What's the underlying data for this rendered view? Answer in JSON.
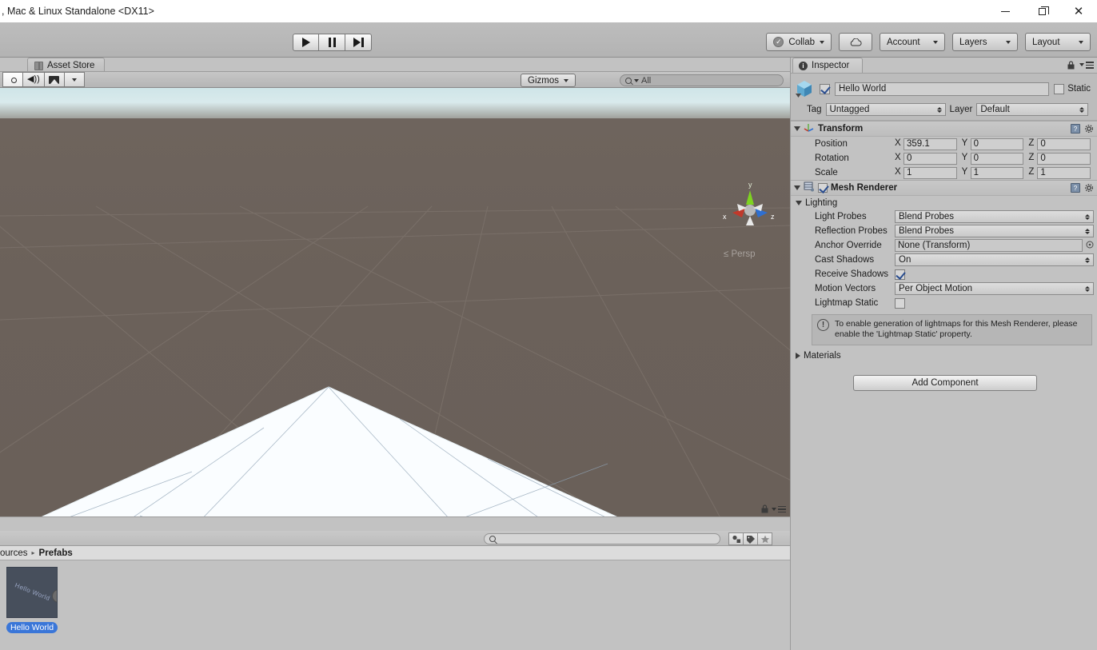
{
  "window": {
    "title": ", Mac & Linux Standalone <DX11>",
    "minimize": "—",
    "maximize": "❐",
    "close": "✕"
  },
  "toolbar": {
    "play": "play-icon",
    "pause": "pause-icon",
    "step": "step-icon",
    "collab_label": "Collab",
    "cloud_label": "cloud-icon",
    "account_label": "Account",
    "layers_label": "Layers",
    "layout_label": "Layout"
  },
  "scene": {
    "tab_label": "Asset Store",
    "gizmos_label": "Gizmos",
    "search_value": "All",
    "search_placeholder": "All",
    "axis_x": "x",
    "axis_y": "y",
    "axis_z": "z",
    "perspective_label": "Persp",
    "toggles": {
      "lighting": "sun-icon",
      "audio": "speaker-icon",
      "effects": "image-icon"
    }
  },
  "project": {
    "search_value": "",
    "breadcrumb_parent": "ources",
    "breadcrumb_sep": "▸",
    "breadcrumb_current": "Prefabs",
    "filters": {
      "type": "object-filter-icon",
      "label": "tag-filter-icon",
      "favorite": "star-icon"
    },
    "assets": [
      {
        "name": "Hello World",
        "thumb_text": "Hello World"
      }
    ]
  },
  "inspector": {
    "tab_label": "Inspector",
    "gameobject": {
      "name": "Hello World",
      "enabled": true,
      "static_label": "Static",
      "static_checked": false,
      "tag_label": "Tag",
      "tag_value": "Untagged",
      "layer_label": "Layer",
      "layer_value": "Default"
    },
    "transform": {
      "title": "Transform",
      "rows": [
        {
          "label": "Position",
          "x": "359.1",
          "y": "0",
          "z": "0"
        },
        {
          "label": "Rotation",
          "x": "0",
          "y": "0",
          "z": "0"
        },
        {
          "label": "Scale",
          "x": "1",
          "y": "1",
          "z": "1"
        }
      ],
      "axis_x": "X",
      "axis_y": "Y",
      "axis_z": "Z"
    },
    "mesh_renderer": {
      "title": "Mesh Renderer",
      "enabled": true,
      "lighting_label": "Lighting",
      "light_probes_label": "Light Probes",
      "light_probes_value": "Blend Probes",
      "reflection_probes_label": "Reflection Probes",
      "reflection_probes_value": "Blend Probes",
      "anchor_override_label": "Anchor Override",
      "anchor_override_value": "None (Transform)",
      "cast_shadows_label": "Cast Shadows",
      "cast_shadows_value": "On",
      "receive_shadows_label": "Receive Shadows",
      "receive_shadows_checked": true,
      "motion_vectors_label": "Motion Vectors",
      "motion_vectors_value": "Per Object Motion",
      "lightmap_static_label": "Lightmap Static",
      "lightmap_static_checked": false,
      "help_text": "To enable generation of lightmaps for this Mesh Renderer, please enable the 'Lightmap Static' property.",
      "materials_label": "Materials"
    },
    "add_component_label": "Add Component"
  },
  "colors": {
    "chrome": "#c2c2c2",
    "selection_blue": "#3a76d8",
    "axis_x": "#c0392b",
    "axis_y": "#7ed321",
    "axis_z": "#2f6fd0",
    "ground": "#6a6059",
    "sky": "#d3e7ea"
  }
}
